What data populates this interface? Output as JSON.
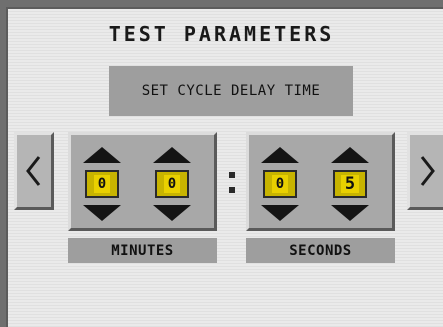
{
  "title": "TEST PARAMETERS",
  "subtitle": "SET CYCLE DELAY TIME",
  "navigation": {
    "prev_icon": "chevron-left-icon",
    "next_icon": "chevron-right-icon"
  },
  "separator": ":",
  "minutes": {
    "label": "MINUTES",
    "tens": "0",
    "ones": "0"
  },
  "seconds": {
    "label": "SECONDS",
    "tens": "0",
    "ones": "5"
  },
  "colors": {
    "panel": "#a8a8a8",
    "digit_background": "#e9d000",
    "label_background": "#9e9e9e",
    "screen": "#eaeaea"
  }
}
